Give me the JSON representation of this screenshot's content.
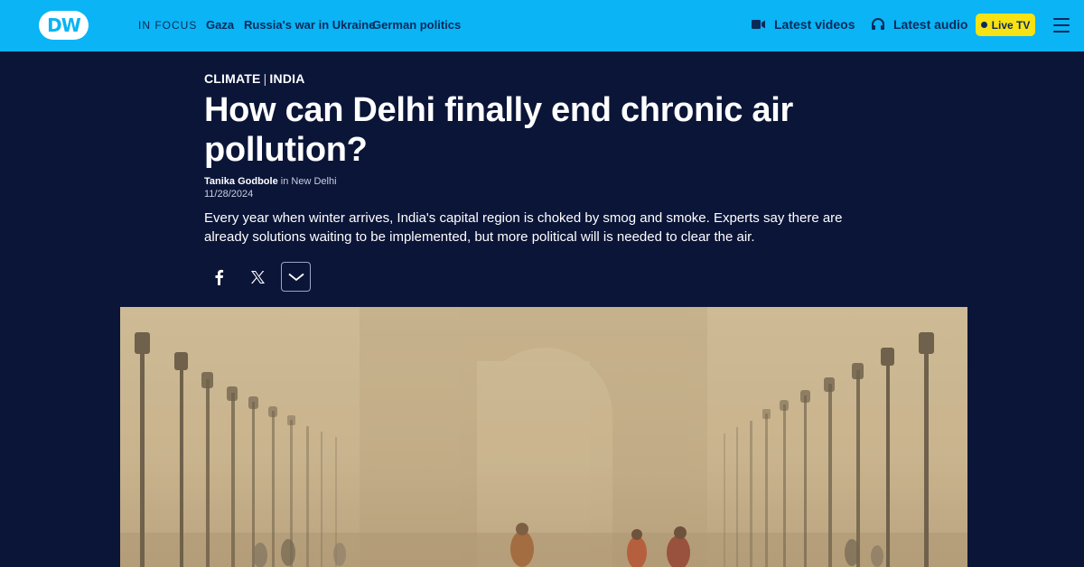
{
  "brand": {
    "logo_text": "DW",
    "accent": "#0ab4f5",
    "navy": "#0b1538"
  },
  "topnav": {
    "in_focus_label": "IN FOCUS",
    "links": [
      "Gaza",
      "Russia's war in Ukraine",
      "German politics"
    ],
    "latest_videos": "Latest videos",
    "latest_audio": "Latest audio",
    "live_tv": "Live TV"
  },
  "article": {
    "kicker_primary": "CLIMATE",
    "kicker_separator": "|",
    "kicker_secondary": "INDIA",
    "title": "How can Delhi finally end chronic air pollution?",
    "author": "Tanika Godbole",
    "location_prefix": "in",
    "location": "New Delhi",
    "date": "11/28/2024",
    "teaser": "Every year when winter arrives, India's capital region is choked by smog and smoke. Experts say there are already solutions waiting to be implemented, but more political will is needed to clear the air."
  },
  "share": {
    "icons": [
      "facebook-icon",
      "x-icon",
      "chevron-down-icon"
    ]
  },
  "hero_image": {
    "subject": "smog-covered boulevard with lamp posts",
    "tint": "#c9b58f"
  }
}
